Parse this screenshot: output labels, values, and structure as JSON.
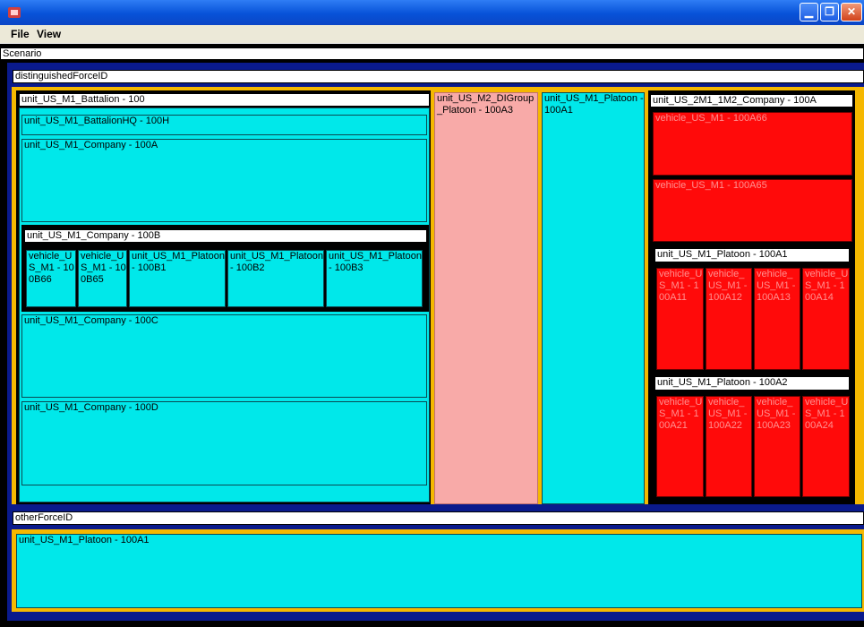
{
  "window": {
    "minimize_glyph": "▁",
    "maximize_glyph": "❐",
    "close_glyph": "✕"
  },
  "menu": {
    "file": "File",
    "view": "View"
  },
  "scenario": {
    "label": "Scenario"
  },
  "distinguished": {
    "label": "distinguishedForceID",
    "battalion": {
      "label": "unit_US_M1_Battalion - 100",
      "hq": "unit_US_M1_BattalionHQ - 100H",
      "company_a": "unit_US_M1_Company - 100A",
      "company_b": {
        "label": "unit_US_M1_Company - 100B",
        "children": [
          "vehicle_US_M1 - 100B66",
          "vehicle_US_M1 - 100B65",
          "unit_US_M1_Platoon - 100B1",
          "unit_US_M1_Platoon - 100B2",
          "unit_US_M1_Platoon - 100B3"
        ]
      },
      "company_c": "unit_US_M1_Company - 100C",
      "company_d": "unit_US_M1_Company - 100D"
    },
    "digroup_platoon": "unit_US_M2_DIGroup_Platoon - 100A3",
    "platoon_100a1": "unit_US_M1_Platoon - 100A1",
    "company_2m1": {
      "label": "unit_US_2M1_1M2_Company - 100A",
      "vehicle_a66": "vehicle_US_M1 - 100A66",
      "vehicle_a65": "vehicle_US_M1 - 100A65",
      "platoon_a1": {
        "label": "unit_US_M1_Platoon - 100A1",
        "vehicles": [
          "vehicle_US_M1 - 100A11",
          "vehicle_US_M1 - 100A12",
          "vehicle_US_M1 - 100A13",
          "vehicle_US_M1 - 100A14"
        ]
      },
      "platoon_a2": {
        "label": "unit_US_M1_Platoon - 100A2",
        "vehicles": [
          "vehicle_US_M1 - 100A21",
          "vehicle_US_M1 - 100A22",
          "vehicle_US_M1 - 100A23",
          "vehicle_US_M1 - 100A24"
        ]
      }
    }
  },
  "other": {
    "label": "otherForceID",
    "platoon": "unit_US_M1_Platoon - 100A1"
  },
  "colors": {
    "titlebar": "#0752d8",
    "force_border": "#0a1a8c",
    "unit_border": "#f5b800",
    "cyan": "#00e8ea",
    "red": "#ff0a0a",
    "pink": "#f8aaa8"
  }
}
